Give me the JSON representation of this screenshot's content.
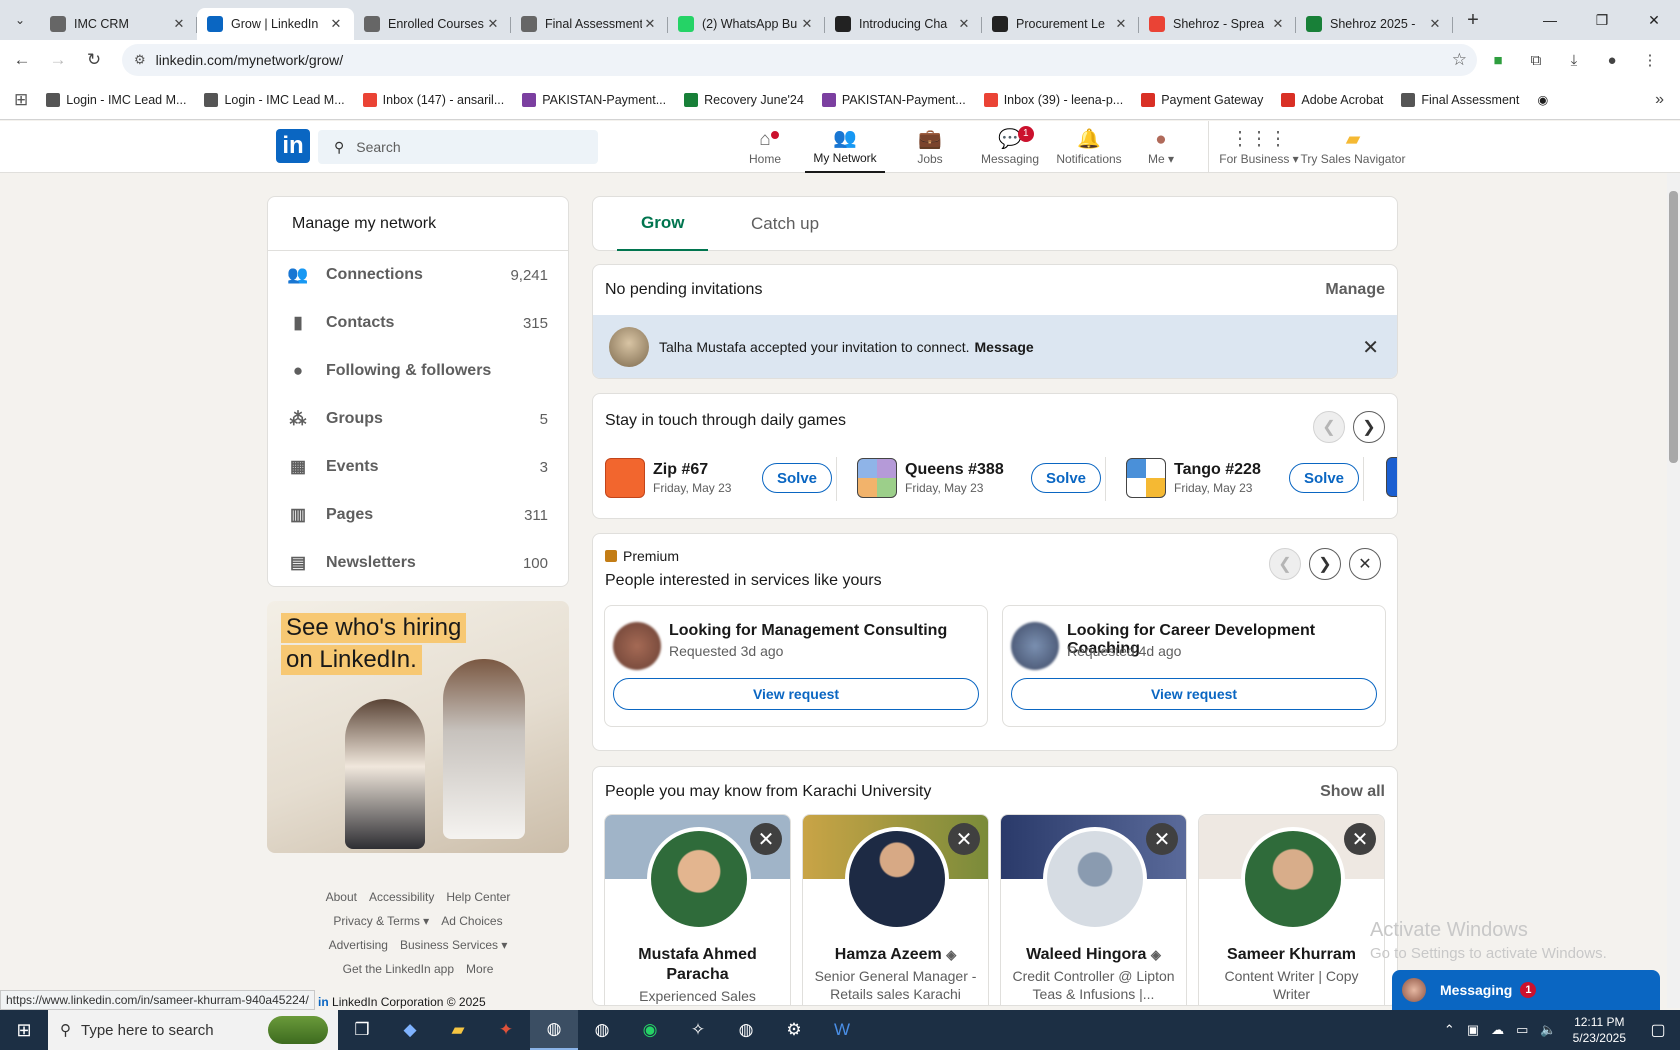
{
  "browser": {
    "tabs": [
      {
        "title": "IMC CRM",
        "favicon": "crm-icon",
        "active": false
      },
      {
        "title": "Grow | LinkedIn",
        "favicon": "linkedin-icon",
        "active": true
      },
      {
        "title": "Enrolled Courses",
        "favicon": "crm-icon",
        "active": false
      },
      {
        "title": "Final Assessment",
        "favicon": "crm-icon",
        "active": false
      },
      {
        "title": "(2) WhatsApp Bu",
        "favicon": "whatsapp-icon",
        "active": false
      },
      {
        "title": "Introducing Cha",
        "favicon": "openai-icon",
        "active": false
      },
      {
        "title": "Procurement Le",
        "favicon": "openai-icon",
        "active": false
      },
      {
        "title": "Shehroz - Sprea",
        "favicon": "gmail-icon",
        "active": false
      },
      {
        "title": "Shehroz 2025 -",
        "favicon": "sheets-icon",
        "active": false
      }
    ],
    "url": "linkedin.com/mynetwork/grow/",
    "bookmarks": [
      {
        "label": "Login - IMC Lead M...",
        "color": "#555555"
      },
      {
        "label": "Login - IMC Lead M...",
        "color": "#555555"
      },
      {
        "label": "Inbox (147) - ansaril...",
        "color": "#ea4335"
      },
      {
        "label": "PAKISTAN-Payment...",
        "color": "#7b3fa0"
      },
      {
        "label": "Recovery June'24",
        "color": "#188038"
      },
      {
        "label": "PAKISTAN-Payment...",
        "color": "#7b3fa0"
      },
      {
        "label": "Inbox (39) - leena-p...",
        "color": "#ea4335"
      },
      {
        "label": "Payment Gateway",
        "color": "#d93025"
      },
      {
        "label": "Adobe Acrobat",
        "color": "#d93025"
      },
      {
        "label": "Final Assessment",
        "color": "#555555"
      }
    ]
  },
  "linkedin": {
    "search_placeholder": "Search",
    "nav": [
      {
        "label": "Home",
        "icon": "home-icon",
        "badge": "dot",
        "active": false
      },
      {
        "label": "My Network",
        "icon": "network-icon",
        "badge": "",
        "active": true
      },
      {
        "label": "Jobs",
        "icon": "briefcase-icon",
        "badge": "",
        "active": false
      },
      {
        "label": "Messaging",
        "icon": "chat-icon",
        "badge": "1",
        "active": false
      },
      {
        "label": "Notifications",
        "icon": "bell-icon",
        "badge": "",
        "active": false
      },
      {
        "label": "Me",
        "icon": "avatar-icon",
        "badge": "",
        "active": false
      },
      {
        "label": "For Business",
        "icon": "grid-icon",
        "badge": "",
        "active": false
      },
      {
        "label": "Try Sales Navigator",
        "icon": "sales-navigator-icon",
        "badge": "",
        "active": false
      }
    ],
    "colors": {
      "brand": "#0a66c2",
      "active_tab": "#01754f",
      "badge": "#cb112d"
    }
  },
  "left": {
    "title": "Manage my network",
    "items": [
      {
        "label": "Connections",
        "count": "9,241",
        "icon": "people-icon"
      },
      {
        "label": "Contacts",
        "count": "315",
        "icon": "contact-book-icon"
      },
      {
        "label": "Following & followers",
        "count": "",
        "icon": "person-icon"
      },
      {
        "label": "Groups",
        "count": "5",
        "icon": "groups-icon"
      },
      {
        "label": "Events",
        "count": "3",
        "icon": "calendar-icon"
      },
      {
        "label": "Pages",
        "count": "311",
        "icon": "building-icon"
      },
      {
        "label": "Newsletters",
        "count": "100",
        "icon": "newspaper-icon"
      }
    ],
    "ad": {
      "line1": "See who's hiring",
      "line2": "on LinkedIn."
    },
    "footer": [
      "About",
      "Accessibility",
      "Help Center",
      "Privacy & Terms ▾",
      "Ad Choices",
      "Advertising",
      "Business Services ▾",
      "Get the LinkedIn app",
      "More"
    ]
  },
  "main": {
    "tabs": [
      "Grow",
      "Catch up"
    ],
    "invitations": {
      "status": "No pending invitations",
      "manage": "Manage",
      "notice": "Talha Mustafa accepted your invitation to connect.",
      "notice_action": "Message"
    },
    "games": {
      "title": "Stay in touch through daily games",
      "items": [
        {
          "name": "Zip #67",
          "date": "Friday, May 23",
          "action": "Solve"
        },
        {
          "name": "Queens #388",
          "date": "Friday, May 23",
          "action": "Solve"
        },
        {
          "name": "Tango #228",
          "date": "Friday, May 23",
          "action": "Solve"
        }
      ]
    },
    "premium": {
      "label": "Premium",
      "title": "People interested in services like yours",
      "requests": [
        {
          "title": "Looking for Management Consulting",
          "sub": "Requested 3d ago",
          "action": "View request"
        },
        {
          "title": "Looking for Career Development Coaching",
          "sub": "Requested 4d ago",
          "action": "View request"
        }
      ]
    },
    "pymk": {
      "title": "People you may know from Karachi University",
      "show_all": "Show all",
      "people": [
        {
          "name": "Mustafa Ahmed Paracha",
          "headline": "Experienced Sales Marketing Manager wit",
          "verified": false
        },
        {
          "name": "Hamza Azeem",
          "headline": "Senior General Manager - Retails sales Karachi",
          "verified": true
        },
        {
          "name": "Waleed Hingora",
          "headline": "Credit Controller @ Lipton Teas & Infusions |...",
          "verified": true
        },
        {
          "name": "Sameer Khurram",
          "headline": "Content Writer | Copy Writer",
          "verified": false
        }
      ]
    }
  },
  "overlay": {
    "activate_title": "Activate Windows",
    "activate_sub": "Go to Settings to activate Windows.",
    "messaging_label": "Messaging",
    "messaging_badge": "1",
    "status_url": "https://www.linkedin.com/in/sameer-khurram-940a45224/",
    "li_footer": "LinkedIn Corporation © 2025"
  },
  "taskbar": {
    "search_placeholder": "Type here to search",
    "time": "12:11 PM",
    "date": "5/23/2025"
  }
}
